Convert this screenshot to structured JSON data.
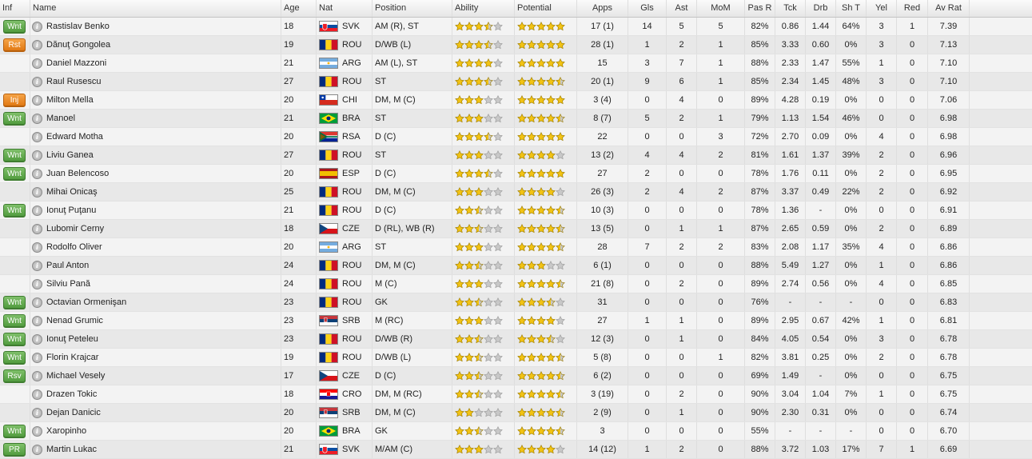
{
  "columns": [
    "Inf",
    "Name",
    "Age",
    "Nat",
    "Position",
    "Ability",
    "Potential",
    "Apps",
    "Gls",
    "Ast",
    "MoM",
    "Pas R",
    "Tck",
    "Drb",
    "Sh T",
    "Yel",
    "Red",
    "Av Rat"
  ],
  "colors": {
    "badge_green": "#5aa545",
    "badge_orange": "#e88620",
    "star_fill": "#f2c313",
    "star_empty": "#c8c8c8"
  },
  "info_icon_symbol": "i",
  "players": [
    {
      "inf": "Wnt",
      "inf_color": "green",
      "name": "Rastislav Benko",
      "age": "18",
      "nat": "SVK",
      "position": "AM (R), ST",
      "ability": 3.5,
      "potential": 5,
      "apps": "17 (1)",
      "gls": "14",
      "ast": "5",
      "mom": "5",
      "pas": "82%",
      "tck": "0.86",
      "drb": "1.44",
      "sht": "64%",
      "yel": "3",
      "red": "1",
      "avr": "7.39"
    },
    {
      "inf": "Rst",
      "inf_color": "orange",
      "name": "Dănuţ Gongolea",
      "age": "19",
      "nat": "ROU",
      "position": "D/WB (L)",
      "ability": 3.5,
      "potential": 5,
      "apps": "28 (1)",
      "gls": "1",
      "ast": "2",
      "mom": "1",
      "pas": "85%",
      "tck": "3.33",
      "drb": "0.60",
      "sht": "0%",
      "yel": "3",
      "red": "0",
      "avr": "7.13"
    },
    {
      "inf": "",
      "inf_color": "",
      "name": "Daniel Mazzoni",
      "age": "21",
      "nat": "ARG",
      "position": "AM (L), ST",
      "ability": 4,
      "potential": 5,
      "apps": "15",
      "gls": "3",
      "ast": "7",
      "mom": "1",
      "pas": "88%",
      "tck": "2.33",
      "drb": "1.47",
      "sht": "55%",
      "yel": "1",
      "red": "0",
      "avr": "7.10"
    },
    {
      "inf": "",
      "inf_color": "",
      "name": "Raul Rusescu",
      "age": "27",
      "nat": "ROU",
      "position": "ST",
      "ability": 3.5,
      "potential": 4.5,
      "apps": "20 (1)",
      "gls": "9",
      "ast": "6",
      "mom": "1",
      "pas": "85%",
      "tck": "2.34",
      "drb": "1.45",
      "sht": "48%",
      "yel": "3",
      "red": "0",
      "avr": "7.10"
    },
    {
      "inf": "Inj",
      "inf_color": "orange",
      "name": "Milton Mella",
      "age": "20",
      "nat": "CHI",
      "position": "DM, M (C)",
      "ability": 3,
      "potential": 5,
      "apps": "3 (4)",
      "gls": "0",
      "ast": "4",
      "mom": "0",
      "pas": "89%",
      "tck": "4.28",
      "drb": "0.19",
      "sht": "0%",
      "yel": "0",
      "red": "0",
      "avr": "7.06"
    },
    {
      "inf": "Wnt",
      "inf_color": "green",
      "name": "Manoel",
      "age": "21",
      "nat": "BRA",
      "position": "ST",
      "ability": 3,
      "potential": 4.5,
      "apps": "8 (7)",
      "gls": "5",
      "ast": "2",
      "mom": "1",
      "pas": "79%",
      "tck": "1.13",
      "drb": "1.54",
      "sht": "46%",
      "yel": "0",
      "red": "0",
      "avr": "6.98"
    },
    {
      "inf": "",
      "inf_color": "",
      "name": "Edward Motha",
      "age": "20",
      "nat": "RSA",
      "position": "D (C)",
      "ability": 3.5,
      "potential": 5,
      "apps": "22",
      "gls": "0",
      "ast": "0",
      "mom": "3",
      "pas": "72%",
      "tck": "2.70",
      "drb": "0.09",
      "sht": "0%",
      "yel": "4",
      "red": "0",
      "avr": "6.98"
    },
    {
      "inf": "Wnt",
      "inf_color": "green",
      "name": "Liviu Ganea",
      "age": "27",
      "nat": "ROU",
      "position": "ST",
      "ability": 3,
      "potential": 4,
      "apps": "13 (2)",
      "gls": "4",
      "ast": "4",
      "mom": "2",
      "pas": "81%",
      "tck": "1.61",
      "drb": "1.37",
      "sht": "39%",
      "yel": "2",
      "red": "0",
      "avr": "6.96"
    },
    {
      "inf": "Wnt",
      "inf_color": "green",
      "name": "Juan Belencoso",
      "age": "20",
      "nat": "ESP",
      "position": "D (C)",
      "ability": 3.5,
      "potential": 5,
      "apps": "27",
      "gls": "2",
      "ast": "0",
      "mom": "0",
      "pas": "78%",
      "tck": "1.76",
      "drb": "0.11",
      "sht": "0%",
      "yel": "2",
      "red": "0",
      "avr": "6.95"
    },
    {
      "inf": "",
      "inf_color": "",
      "name": "Mihai Onicaş",
      "age": "25",
      "nat": "ROU",
      "position": "DM, M (C)",
      "ability": 3,
      "potential": 4,
      "apps": "26 (3)",
      "gls": "2",
      "ast": "4",
      "mom": "2",
      "pas": "87%",
      "tck": "3.37",
      "drb": "0.49",
      "sht": "22%",
      "yel": "2",
      "red": "0",
      "avr": "6.92"
    },
    {
      "inf": "Wnt",
      "inf_color": "green",
      "name": "Ionuţ Puţanu",
      "age": "21",
      "nat": "ROU",
      "position": "D (C)",
      "ability": 2.5,
      "potential": 4.5,
      "apps": "10 (3)",
      "gls": "0",
      "ast": "0",
      "mom": "0",
      "pas": "78%",
      "tck": "1.36",
      "drb": "-",
      "sht": "0%",
      "yel": "0",
      "red": "0",
      "avr": "6.91"
    },
    {
      "inf": "",
      "inf_color": "",
      "name": "Lubomir Cerny",
      "age": "18",
      "nat": "CZE",
      "position": "D (RL), WB (R)",
      "ability": 2.5,
      "potential": 4.5,
      "apps": "13 (5)",
      "gls": "0",
      "ast": "1",
      "mom": "1",
      "pas": "87%",
      "tck": "2.65",
      "drb": "0.59",
      "sht": "0%",
      "yel": "2",
      "red": "0",
      "avr": "6.89"
    },
    {
      "inf": "",
      "inf_color": "",
      "name": "Rodolfo Oliver",
      "age": "20",
      "nat": "ARG",
      "position": "ST",
      "ability": 3,
      "potential": 4.5,
      "apps": "28",
      "gls": "7",
      "ast": "2",
      "mom": "2",
      "pas": "83%",
      "tck": "2.08",
      "drb": "1.17",
      "sht": "35%",
      "yel": "4",
      "red": "0",
      "avr": "6.86"
    },
    {
      "inf": "",
      "inf_color": "",
      "name": "Paul Anton",
      "age": "24",
      "nat": "ROU",
      "position": "DM, M (C)",
      "ability": 2.5,
      "potential": 3,
      "apps": "6 (1)",
      "gls": "0",
      "ast": "0",
      "mom": "0",
      "pas": "88%",
      "tck": "5.49",
      "drb": "1.27",
      "sht": "0%",
      "yel": "1",
      "red": "0",
      "avr": "6.86"
    },
    {
      "inf": "",
      "inf_color": "",
      "name": "Silviu Pană",
      "age": "24",
      "nat": "ROU",
      "position": "M (C)",
      "ability": 3,
      "potential": 4.5,
      "apps": "21 (8)",
      "gls": "0",
      "ast": "2",
      "mom": "0",
      "pas": "89%",
      "tck": "2.74",
      "drb": "0.56",
      "sht": "0%",
      "yel": "4",
      "red": "0",
      "avr": "6.85"
    },
    {
      "inf": "Wnt",
      "inf_color": "green",
      "name": "Octavian Ormenişan",
      "age": "23",
      "nat": "ROU",
      "position": "GK",
      "ability": 2.5,
      "potential": 3.5,
      "apps": "31",
      "gls": "0",
      "ast": "0",
      "mom": "0",
      "pas": "76%",
      "tck": "-",
      "drb": "-",
      "sht": "-",
      "yel": "0",
      "red": "0",
      "avr": "6.83"
    },
    {
      "inf": "Wnt",
      "inf_color": "green",
      "name": "Nenad Grumic",
      "age": "23",
      "nat": "SRB",
      "position": "M (RC)",
      "ability": 3,
      "potential": 4,
      "apps": "27",
      "gls": "1",
      "ast": "1",
      "mom": "0",
      "pas": "89%",
      "tck": "2.95",
      "drb": "0.67",
      "sht": "42%",
      "yel": "1",
      "red": "0",
      "avr": "6.81"
    },
    {
      "inf": "Wnt",
      "inf_color": "green",
      "name": "Ionuţ Peteleu",
      "age": "23",
      "nat": "ROU",
      "position": "D/WB (R)",
      "ability": 2.5,
      "potential": 3.5,
      "apps": "12 (3)",
      "gls": "0",
      "ast": "1",
      "mom": "0",
      "pas": "84%",
      "tck": "4.05",
      "drb": "0.54",
      "sht": "0%",
      "yel": "3",
      "red": "0",
      "avr": "6.78"
    },
    {
      "inf": "Wnt",
      "inf_color": "green",
      "name": "Florin Krajcar",
      "age": "19",
      "nat": "ROU",
      "position": "D/WB (L)",
      "ability": 2.5,
      "potential": 4.5,
      "apps": "5 (8)",
      "gls": "0",
      "ast": "0",
      "mom": "1",
      "pas": "82%",
      "tck": "3.81",
      "drb": "0.25",
      "sht": "0%",
      "yel": "2",
      "red": "0",
      "avr": "6.78"
    },
    {
      "inf": "Rsv",
      "inf_color": "green",
      "name": "Michael Vesely",
      "age": "17",
      "nat": "CZE",
      "position": "D (C)",
      "ability": 2.5,
      "potential": 4.5,
      "apps": "6 (2)",
      "gls": "0",
      "ast": "0",
      "mom": "0",
      "pas": "69%",
      "tck": "1.49",
      "drb": "-",
      "sht": "0%",
      "yel": "0",
      "red": "0",
      "avr": "6.75"
    },
    {
      "inf": "",
      "inf_color": "",
      "name": "Drazen Tokic",
      "age": "18",
      "nat": "CRO",
      "position": "DM, M (RC)",
      "ability": 2.5,
      "potential": 4.5,
      "apps": "3 (19)",
      "gls": "0",
      "ast": "2",
      "mom": "0",
      "pas": "90%",
      "tck": "3.04",
      "drb": "1.04",
      "sht": "7%",
      "yel": "1",
      "red": "0",
      "avr": "6.75"
    },
    {
      "inf": "",
      "inf_color": "",
      "name": "Dejan Danicic",
      "age": "20",
      "nat": "SRB",
      "position": "DM, M (C)",
      "ability": 2,
      "potential": 4.5,
      "apps": "2 (9)",
      "gls": "0",
      "ast": "1",
      "mom": "0",
      "pas": "90%",
      "tck": "2.30",
      "drb": "0.31",
      "sht": "0%",
      "yel": "0",
      "red": "0",
      "avr": "6.74"
    },
    {
      "inf": "Wnt",
      "inf_color": "green",
      "name": "Xaropinho",
      "age": "20",
      "nat": "BRA",
      "position": "GK",
      "ability": 2.5,
      "potential": 4.5,
      "apps": "3",
      "gls": "0",
      "ast": "0",
      "mom": "0",
      "pas": "55%",
      "tck": "-",
      "drb": "-",
      "sht": "-",
      "yel": "0",
      "red": "0",
      "avr": "6.70"
    },
    {
      "inf": "PR",
      "inf_color": "green",
      "name": "Martin Lukac",
      "age": "21",
      "nat": "SVK",
      "position": "M/AM (C)",
      "ability": 3,
      "potential": 4,
      "apps": "14 (12)",
      "gls": "1",
      "ast": "2",
      "mom": "0",
      "pas": "88%",
      "tck": "3.72",
      "drb": "1.03",
      "sht": "17%",
      "yel": "7",
      "red": "1",
      "avr": "6.69"
    }
  ]
}
